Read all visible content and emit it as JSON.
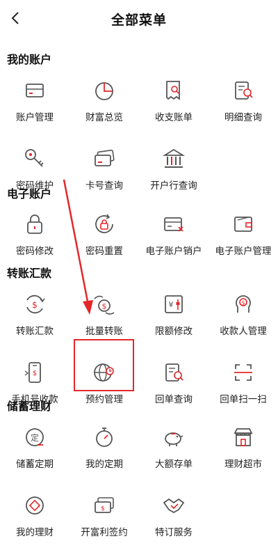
{
  "header": {
    "title": "全部菜单",
    "back_icon": "chevron-left-icon"
  },
  "colors": {
    "accent": "#e3262a",
    "icon_gray": "#555555"
  },
  "sections": [
    {
      "title": "我的账户",
      "items": [
        {
          "label": "账户管理",
          "icon": "card-icon"
        },
        {
          "label": "财富总览",
          "icon": "pie-chart-icon"
        },
        {
          "label": "收支账单",
          "icon": "bill-search-icon"
        },
        {
          "label": "明细查询",
          "icon": "detail-search-icon"
        },
        {
          "label": "密码维护",
          "icon": "key-icon"
        },
        {
          "label": "卡号查询",
          "icon": "card-query-icon"
        },
        {
          "label": "开户行查询",
          "icon": "bank-icon"
        }
      ]
    },
    {
      "title": "电子账户",
      "items": [
        {
          "label": "密码修改",
          "icon": "lock-icon"
        },
        {
          "label": "密码重置",
          "icon": "lock-reset-icon"
        },
        {
          "label": "电子账户销户",
          "icon": "card-close-icon"
        },
        {
          "label": "电子账户管理",
          "icon": "wallet-icon"
        }
      ]
    },
    {
      "title": "转账汇款",
      "items": [
        {
          "label": "转账汇款",
          "icon": "transfer-icon"
        },
        {
          "label": "批量转账",
          "icon": "batch-transfer-icon"
        },
        {
          "label": "限额修改",
          "icon": "limit-icon"
        },
        {
          "label": "收款人管理",
          "icon": "payee-icon"
        },
        {
          "label": "手机号收款",
          "icon": "phone-icon"
        },
        {
          "label": "预约管理",
          "icon": "globe-clock-icon"
        },
        {
          "label": "回单查询",
          "icon": "receipt-search-icon"
        },
        {
          "label": "回单扫一扫",
          "icon": "scan-icon"
        }
      ]
    },
    {
      "title": "储蓄理财",
      "items": [
        {
          "label": "储蓄定期",
          "icon": "fixed-deposit-icon"
        },
        {
          "label": "我的定期",
          "icon": "stopwatch-icon"
        },
        {
          "label": "大额存单",
          "icon": "piggy-icon"
        },
        {
          "label": "理财超市",
          "icon": "shop-icon"
        },
        {
          "label": "我的理财",
          "icon": "finance-icon"
        },
        {
          "label": "开富利签约",
          "icon": "contract-card-icon"
        },
        {
          "label": "特订服务",
          "icon": "handshake-icon"
        }
      ]
    }
  ]
}
